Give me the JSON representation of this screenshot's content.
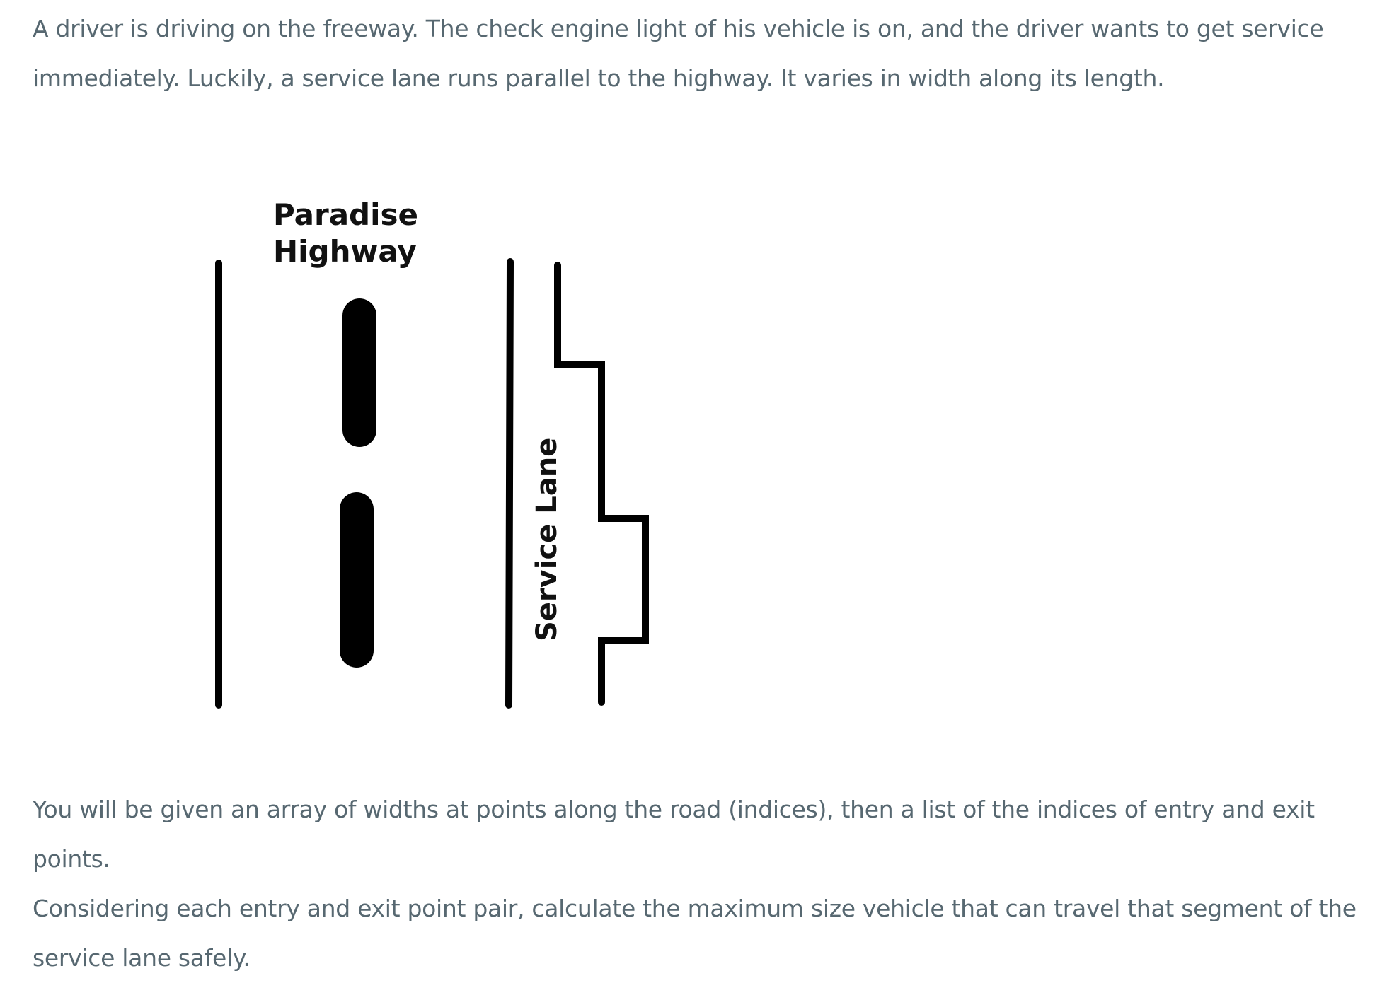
{
  "intro_text_line1": "A driver is driving on the freeway. The check engine light of his vehicle is on, and the driver wants to get service",
  "intro_text_line2": "immediately. Luckily, a service lane runs parallel to the highway. It varies in width along its length.",
  "diagram": {
    "highway_label_line1": "Paradise",
    "highway_label_line2": "Highway",
    "service_lane_label": "Service Lane"
  },
  "task_text_line1": "You will be given an array of widths at points along the road (indices), then a list of the indices of entry and exit points.",
  "task_text_line2": "Considering each entry and exit point pair, calculate the maximum size vehicle that can travel that segment of the",
  "task_text_line3": "service lane safely."
}
